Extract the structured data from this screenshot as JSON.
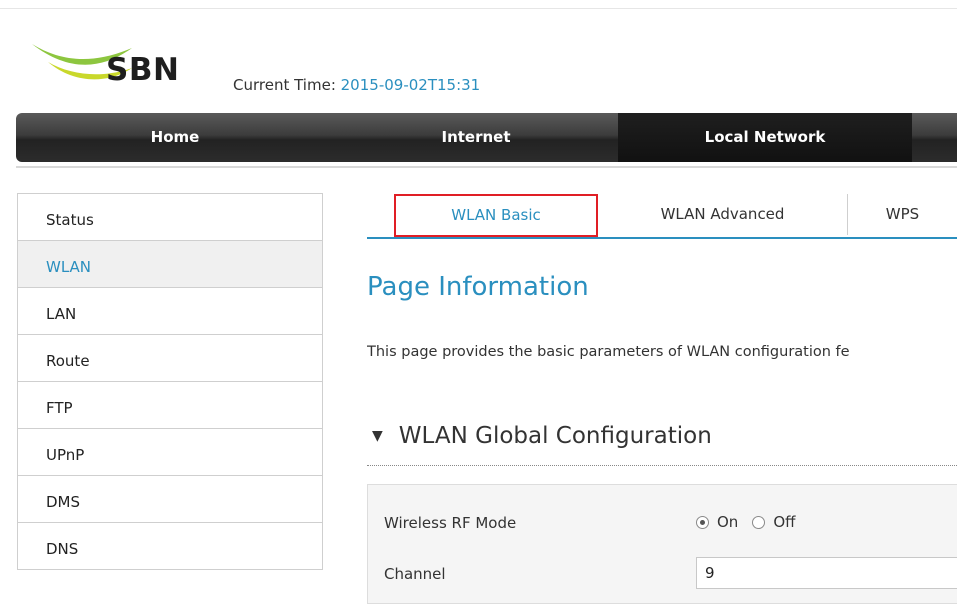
{
  "header": {
    "logo_text": "SBN",
    "current_time_label": "Current Time: ",
    "current_time_value": "2015-09-02T15:31"
  },
  "nav": [
    {
      "label": "Home"
    },
    {
      "label": "Internet"
    },
    {
      "label": "Local Network"
    }
  ],
  "sidebar": {
    "items": [
      {
        "label": "Status"
      },
      {
        "label": "WLAN"
      },
      {
        "label": "LAN"
      },
      {
        "label": "Route"
      },
      {
        "label": "FTP"
      },
      {
        "label": "UPnP"
      },
      {
        "label": "DMS"
      },
      {
        "label": "DNS"
      }
    ],
    "active": "WLAN"
  },
  "tabs": [
    {
      "label": "WLAN Basic"
    },
    {
      "label": "WLAN Advanced"
    },
    {
      "label": "WPS"
    }
  ],
  "page_info": {
    "title": "Page Information",
    "description": "This page provides the basic parameters of WLAN configuration fe"
  },
  "section": {
    "title": "WLAN Global Configuration"
  },
  "form": {
    "rf_mode_label": "Wireless RF Mode",
    "rf_on_label": "On",
    "rf_off_label": "Off",
    "rf_selected": "On",
    "channel_label": "Channel",
    "channel_value": "9"
  },
  "colors": {
    "accent": "#2a8fbf",
    "highlight_border": "#e01e25",
    "nav_bg": "#2c2c2c",
    "logo_green": "#8dc63f"
  }
}
